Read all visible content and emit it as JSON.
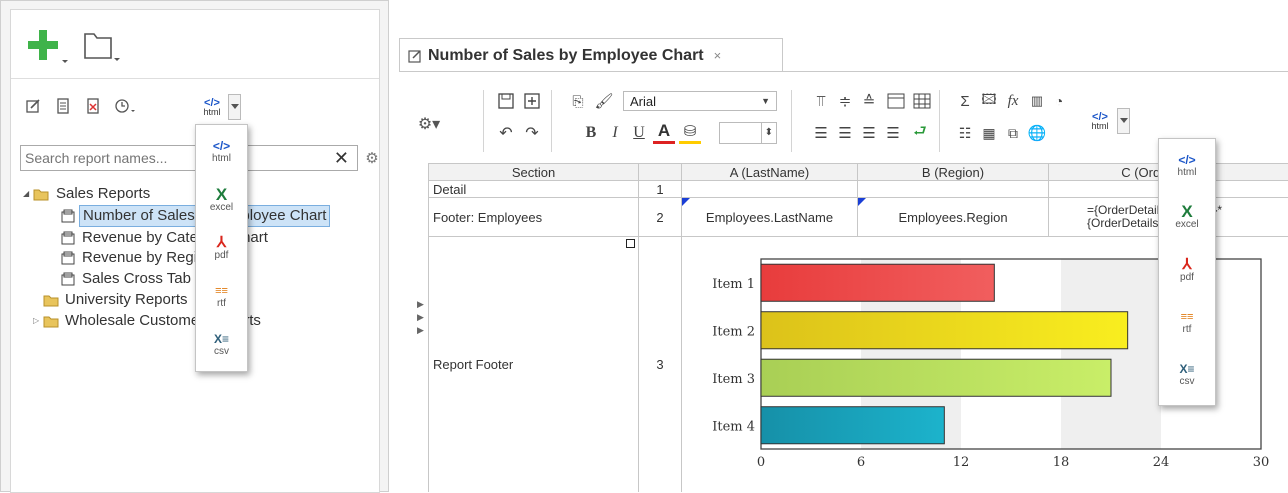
{
  "left": {
    "search_placeholder": "Search report names...",
    "tree": [
      {
        "label": "Sales Reports",
        "type": "folder-open"
      },
      {
        "label": "Number of Sales by Employee Chart",
        "type": "report",
        "selected": true
      },
      {
        "label": "Revenue by Category Chart",
        "type": "report"
      },
      {
        "label": "Revenue by Region",
        "type": "report"
      },
      {
        "label": "Sales Cross Tab",
        "type": "report"
      },
      {
        "label": "University Reports",
        "type": "folder"
      },
      {
        "label": "Wholesale Customer Reports",
        "type": "folder"
      }
    ],
    "export_formats": [
      {
        "symbol": "</>",
        "caption": "html",
        "color": "#1a55c8"
      },
      {
        "symbol": "X",
        "caption": "excel",
        "color": "#1e7c3c"
      },
      {
        "symbol": "⅄",
        "caption": "pdf",
        "color": "#d9261c"
      },
      {
        "symbol": "≡≡",
        "caption": "rtf",
        "color": "#e07b12"
      },
      {
        "symbol": "X≡",
        "caption": "csv",
        "color": "#2f5f7a"
      }
    ],
    "toolbar_html_label": "html"
  },
  "editor": {
    "tab_title": "Number of Sales by Employee Chart",
    "tab_close": "×",
    "font_name": "Arial",
    "html_label": "html",
    "columns": [
      "Section",
      "",
      "A (LastName)",
      "B (Region)",
      "C (OrderDetails)"
    ],
    "rows": [
      {
        "section": "Detail",
        "num": "1",
        "a": "",
        "b": "",
        "c1": "",
        "c2": ""
      },
      {
        "section": "Footer: Employees",
        "num": "2",
        "a": "Employees.LastName",
        "b": "Employees.Region",
        "c1": "={OrderDetails.Quantity}*",
        "c2": "{OrderDetails.UnitPrice}"
      },
      {
        "section": "Report Footer",
        "num": "3",
        "a": "",
        "b": "",
        "c1": "",
        "c2": ""
      }
    ]
  },
  "chart_data": {
    "type": "bar",
    "orientation": "horizontal",
    "categories": [
      "Item 1",
      "Item 2",
      "Item 3",
      "Item 4"
    ],
    "values": [
      14,
      22,
      21,
      11
    ],
    "colors": [
      [
        "#e83c3c",
        "#f15e5e"
      ],
      [
        "#dcc21a",
        "#f9ee1f"
      ],
      [
        "#a9cf55",
        "#c9ee68"
      ],
      [
        "#1690a8",
        "#1cb3cc"
      ]
    ],
    "xlim": [
      0,
      30
    ],
    "xticks": [
      0,
      6,
      12,
      18,
      24,
      30
    ],
    "grid": true
  }
}
